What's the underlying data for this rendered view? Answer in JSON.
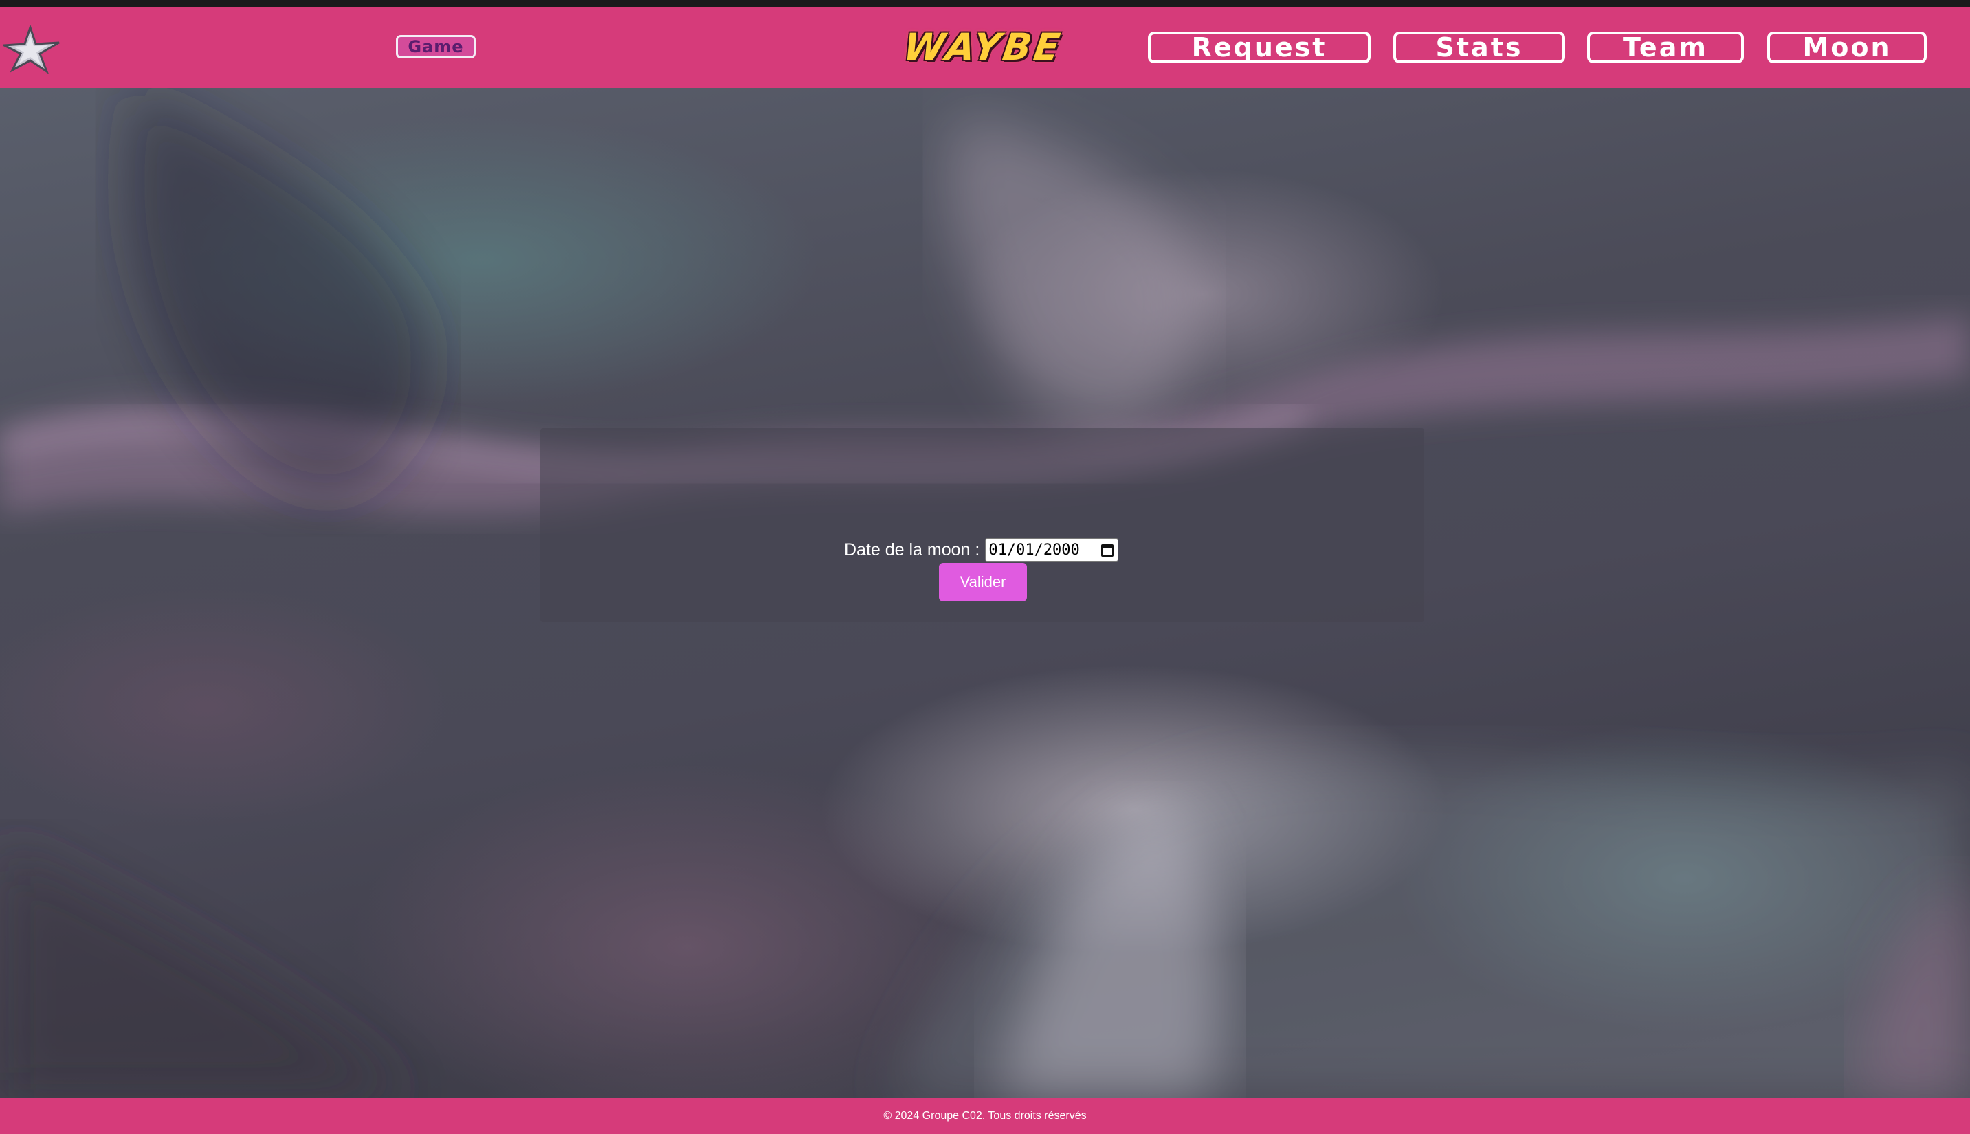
{
  "header": {
    "logo_icon": "star-logo-icon",
    "game_label": "Game",
    "brand_text": "WAYBE",
    "nav": [
      {
        "label": "Request"
      },
      {
        "label": "Stats"
      },
      {
        "label": "Team"
      },
      {
        "label": "Moon"
      }
    ]
  },
  "form": {
    "label": "Date de la moon :",
    "date_value": "01/01/2000",
    "calendar_icon": "calendar-icon",
    "submit_label": "Valider"
  },
  "footer": {
    "text": "© 2024 Groupe C02. Tous droits réservés"
  },
  "colors": {
    "header_bg": "#d63b7a",
    "submit_bg": "#e05be0",
    "brand_yellow": "#ffcf3a"
  }
}
